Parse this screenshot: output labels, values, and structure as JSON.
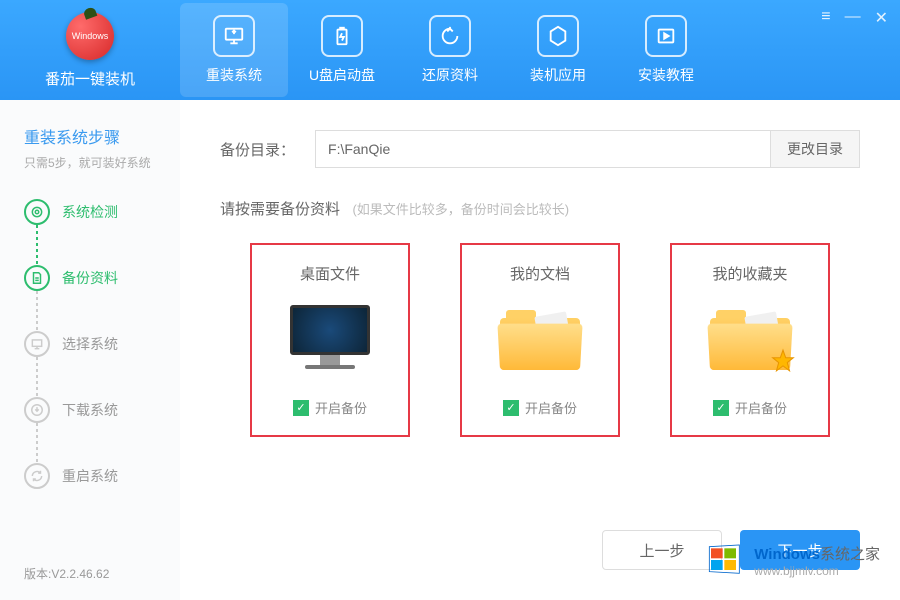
{
  "app": {
    "logo_text": "番茄一键装机",
    "logo_small": "Windows"
  },
  "nav": [
    {
      "label": "重装系统",
      "icon": "monitor"
    },
    {
      "label": "U盘启动盘",
      "icon": "battery"
    },
    {
      "label": "还原资料",
      "icon": "restore"
    },
    {
      "label": "装机应用",
      "icon": "hexagon"
    },
    {
      "label": "安装教程",
      "icon": "play"
    }
  ],
  "sidebar": {
    "title": "重装系统步骤",
    "subtitle": "只需5步，就可装好系统",
    "steps": [
      {
        "label": "系统检测",
        "state": "done",
        "icon": "scan"
      },
      {
        "label": "备份资料",
        "state": "done",
        "icon": "doc"
      },
      {
        "label": "选择系统",
        "state": "pending",
        "icon": "screen"
      },
      {
        "label": "下载系统",
        "state": "pending",
        "icon": "download"
      },
      {
        "label": "重启系统",
        "state": "pending",
        "icon": "refresh"
      }
    ],
    "version": "版本:V2.2.46.62"
  },
  "main": {
    "backup_label": "备份目录：",
    "backup_path": "F:\\FanQie",
    "change_btn": "更改目录",
    "hint_main": "请按需要备份资料",
    "hint_sub": "(如果文件比较多，备份时间会比较长)",
    "cards": [
      {
        "title": "桌面文件",
        "check_label": "开启备份",
        "checked": true,
        "visual": "monitor"
      },
      {
        "title": "我的文档",
        "check_label": "开启备份",
        "checked": true,
        "visual": "folder"
      },
      {
        "title": "我的收藏夹",
        "check_label": "开启备份",
        "checked": true,
        "visual": "folder-star"
      }
    ],
    "btn_prev": "上一步",
    "btn_next": "下一步"
  },
  "watermark": {
    "brand_blue": "Windows",
    "brand_gray": "系统之家",
    "url": "www.bjjmlv.com"
  }
}
